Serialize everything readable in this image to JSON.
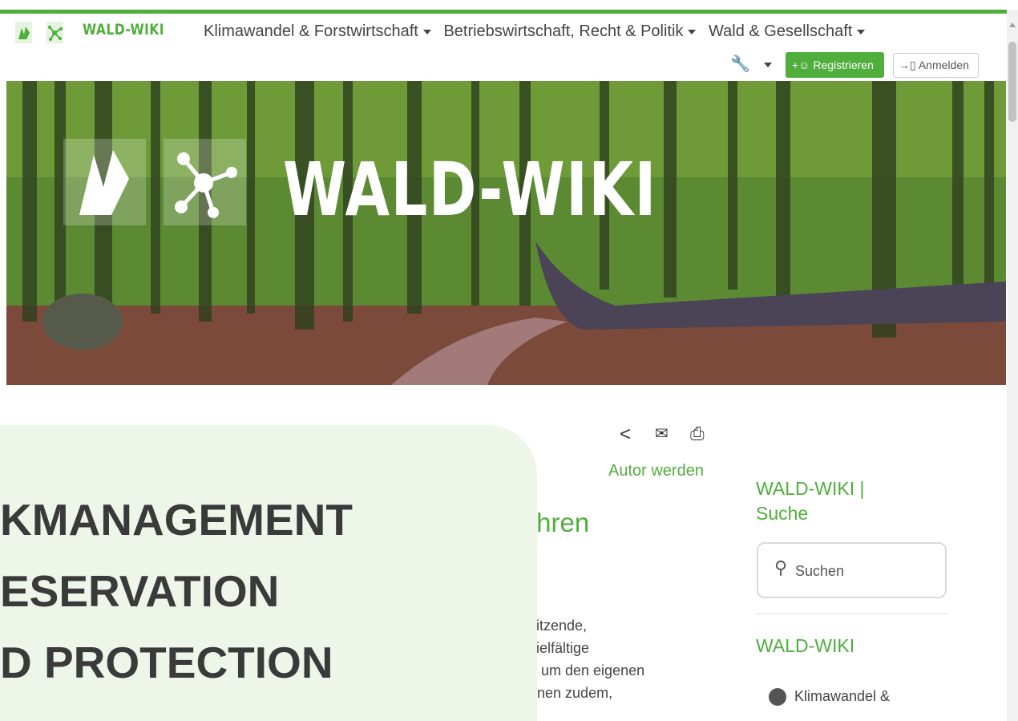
{
  "header": {
    "logo_text": "WALD-WIKI",
    "menu": [
      {
        "label": "Klimawandel & Forstwirtschaft"
      },
      {
        "label": "Betriebswirtschaft, Recht & Politik"
      },
      {
        "label": "Wald & Gesellschaft"
      }
    ],
    "register_label": "Registrieren",
    "login_label": "Anmelden"
  },
  "hero": {
    "title": "WALD-WIKI"
  },
  "article": {
    "autor_label": "Autor werden",
    "heading_fragment": "Ihren",
    "body_fragments": [
      "sitzende,",
      "vielfältige",
      "d um den eigenen",
      "nnen zudem,"
    ]
  },
  "overlay": {
    "lines": [
      "KMANAGEMENT",
      "ESERVATION",
      "D PROTECTION"
    ]
  },
  "sidebar": {
    "search_title": "WALD-WIKI | Suche",
    "search_placeholder": "Suchen",
    "section_title": "WALD-WIKI",
    "items": [
      {
        "label": "Klimawandel &"
      }
    ]
  },
  "colors": {
    "brand_green": "#4fae3c",
    "overlay_bg": "#eef6ea"
  }
}
